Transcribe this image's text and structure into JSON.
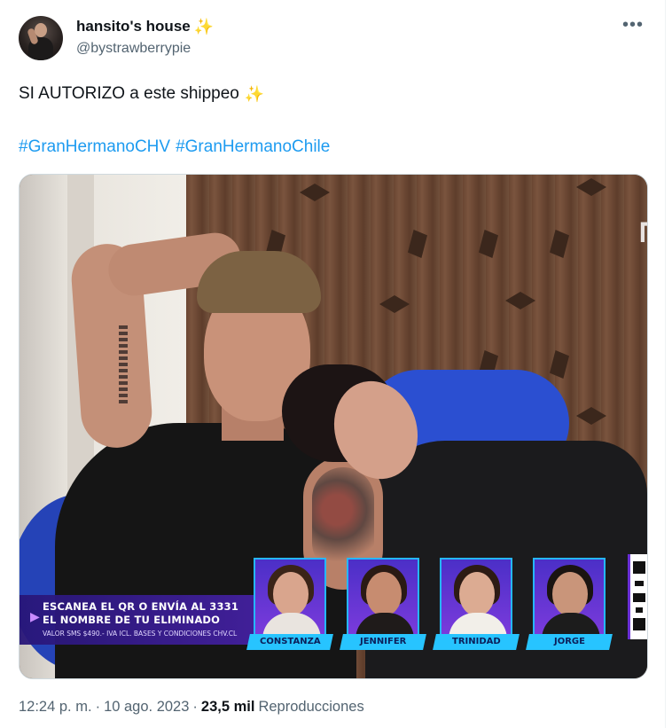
{
  "author": {
    "display_name": "hansito's house",
    "name_emoji": "✨",
    "handle": "@bystrawberrypie",
    "avatar_icon": "user-avatar"
  },
  "menu": {
    "more_label": "•••"
  },
  "tweet": {
    "text": "SI AUTORIZO a este shippeo",
    "text_emoji": "✨",
    "hashtags": [
      "#GranHermanoCHV",
      "#GranHermanoChile"
    ]
  },
  "media": {
    "banner": {
      "line1": "ESCANEA EL QR O ENVÍA AL 3331",
      "line2": "EL NOMBRE DE TU ELIMINADO",
      "line3": "VALOR SMS $490.- IVA ICL. BASES Y CONDICIONES CHV.CL"
    },
    "nominees": [
      "CONSTANZA",
      "JENNIFER",
      "TRINIDAD",
      "JORGE"
    ],
    "accent_color": "#27c4ff",
    "banner_color": "#4922aa"
  },
  "footer": {
    "time": "12:24 p. m.",
    "separator": "·",
    "date": "10 ago. 2023",
    "views_count": "23,5 mil",
    "views_label": "Reproducciones"
  },
  "colors": {
    "link": "#1d9bf0",
    "secondary_text": "#536471",
    "primary_text": "#0f1419"
  }
}
